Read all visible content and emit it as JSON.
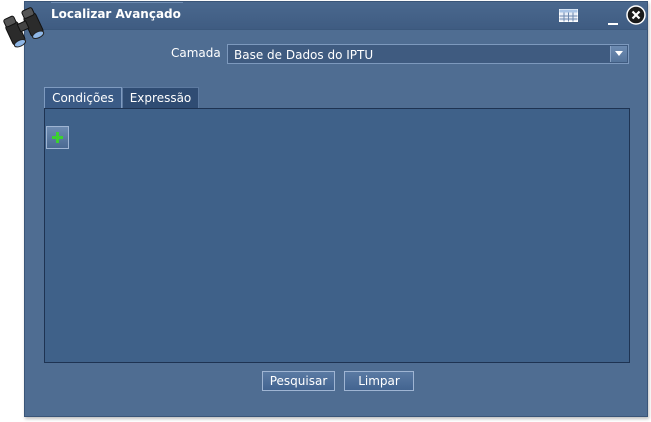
{
  "window": {
    "title": "Localizar Avançado",
    "icons": {
      "logo": "binoculars-icon",
      "grid": "table-icon",
      "minimize": "minimize-icon",
      "close": "close-icon"
    }
  },
  "form": {
    "layer_label": "Camada",
    "layer_value": "Base de Dados do IPTU"
  },
  "tabs": [
    {
      "label": "Condições",
      "active": true
    },
    {
      "label": "Expressão",
      "active": false
    }
  ],
  "conditions": {
    "add_icon": "plus-icon"
  },
  "actions": {
    "search_label": "Pesquisar",
    "clear_label": "Limpar"
  },
  "colors": {
    "window_bg": "#4f6d92",
    "panel_bg": "#3f6189",
    "accent_green": "#3bd12f"
  }
}
